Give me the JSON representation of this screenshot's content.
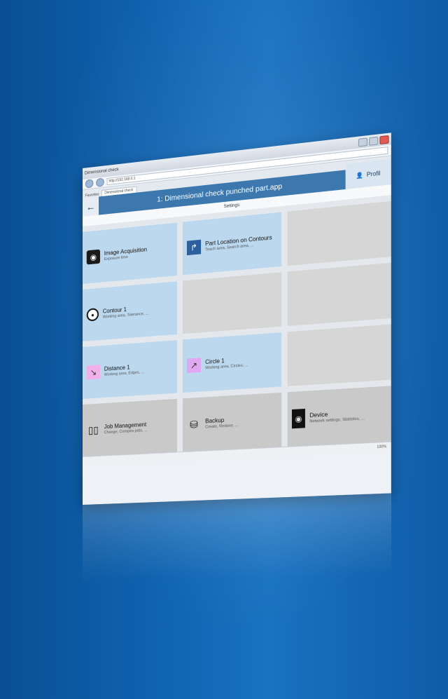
{
  "browser": {
    "window_title": "Dimensional check",
    "address": "http://192.168.0.1",
    "tab_label": "Dimensional check",
    "favorites_label": "Favorites"
  },
  "app": {
    "title": "1: Dimensional check punched part.app",
    "breadcrumb": "Settings",
    "back_icon": "←",
    "profile_label": "Profil"
  },
  "tiles": [
    {
      "title": "Image Acquisition",
      "subtitle": "Exposure time",
      "style": "blue"
    },
    {
      "title": "Part Location on Contours",
      "subtitle": "Teach area, Search area, ...",
      "style": "blue"
    },
    {
      "title": "",
      "subtitle": "",
      "style": "empty"
    },
    {
      "title": "Contour 1",
      "subtitle": "Working area, Tolerance, ...",
      "style": "blue"
    },
    {
      "title": "",
      "subtitle": "",
      "style": "empty"
    },
    {
      "title": "",
      "subtitle": "",
      "style": "empty"
    },
    {
      "title": "Distance 1",
      "subtitle": "Working area, Edges, ...",
      "style": "blue"
    },
    {
      "title": "Circle 1",
      "subtitle": "Working area, Circles, ...",
      "style": "blue"
    },
    {
      "title": "",
      "subtitle": "",
      "style": "empty"
    },
    {
      "title": "Job Management",
      "subtitle": "Change, Complex jobs, ...",
      "style": "gray"
    },
    {
      "title": "Backup",
      "subtitle": "Create, Restore, ...",
      "style": "gray"
    },
    {
      "title": "Device",
      "subtitle": "Network settings, Statistics, ...",
      "style": "gray"
    }
  ],
  "statusbar": {
    "zoom": "100%"
  },
  "colors": {
    "accent": "#3c78ad",
    "tile_blue": "#bcd8ef",
    "tile_gray": "#c9c9c9"
  }
}
